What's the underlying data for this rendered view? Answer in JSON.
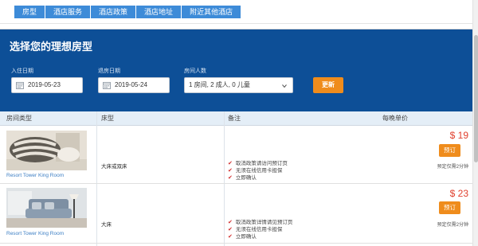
{
  "nav": {
    "tabs": [
      "房型",
      "酒店服务",
      "酒店政策",
      "酒店地址",
      "附近其他酒店"
    ]
  },
  "search": {
    "title": "选择您的理想房型",
    "checkin_label": "入住日期",
    "checkin_value": "2019-05-23",
    "checkout_label": "退房日期",
    "checkout_value": "2019-05-24",
    "guests_label": "房间人数",
    "guests_value": "1 房间, 2 成人, 0 儿童",
    "button": "更新"
  },
  "table": {
    "headers": [
      "房间类型",
      "床型",
      "备注",
      "每晚单价"
    ],
    "rows": [
      {
        "room_name": "Resort Tower King Room",
        "bed": "大床或双床",
        "policies": [
          "取消政策请访问预订页",
          "无须在线信用卡担保",
          "立即确认"
        ],
        "price": "$ 19",
        "book_label": "预订",
        "remain": "预定仅需2分钟"
      },
      {
        "room_name": "Resort Tower King Room",
        "bed": "大床",
        "policies": [
          "取消政策详情请见预订页",
          "无须在线信用卡担保",
          "立即确认"
        ],
        "price": "$ 23",
        "book_label": "预订",
        "remain": "预定仅需2分钟"
      }
    ]
  },
  "colors": {
    "nav": "#3d8bd8",
    "header": "#0d4f97",
    "accent": "#ef8c1c",
    "price": "#e0402e"
  }
}
